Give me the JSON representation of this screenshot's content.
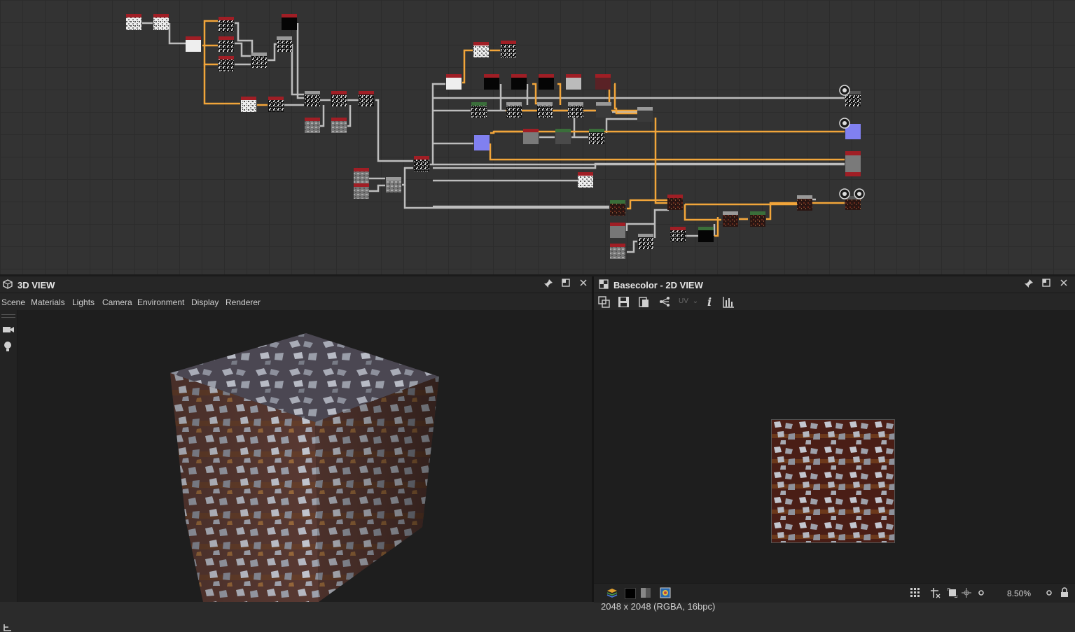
{
  "panel_3d": {
    "title": "3D VIEW",
    "menu": [
      "Scene",
      "Materials",
      "Lights",
      "Camera",
      "Environment",
      "Display",
      "Renderer"
    ]
  },
  "panel_2d": {
    "title": "Basecolor - 2D VIEW",
    "uv_label": "UV",
    "resolution_info": "2048 x 2048 (RGBA, 16bpc)",
    "zoom": "8.50%"
  },
  "colors": {
    "accent_orange": "#f2a53a",
    "link_gray": "#b8b8b8",
    "node_header_red": "#a01e25",
    "normal_purple": "#8080f0"
  }
}
